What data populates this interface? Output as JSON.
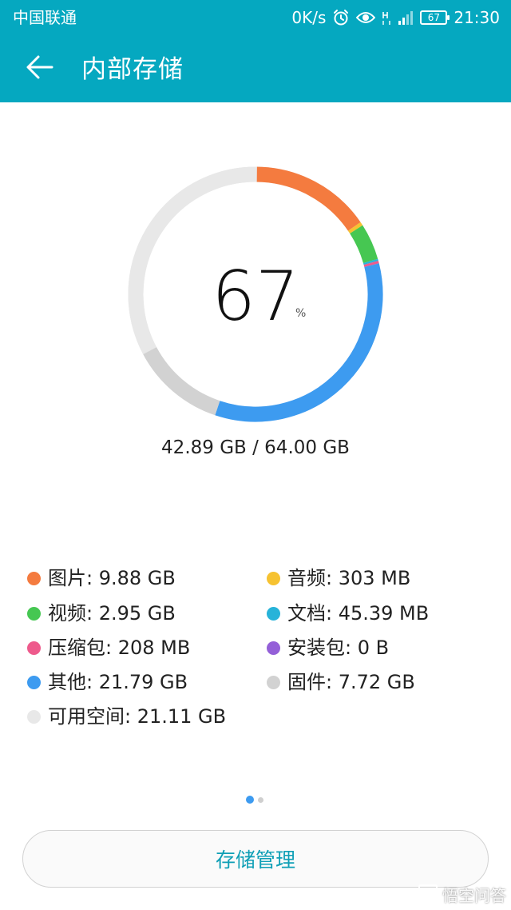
{
  "status_bar": {
    "carrier": "中国联通",
    "net_speed": "0K/s",
    "battery": "67",
    "time": "21:30",
    "icons": [
      "alarm-icon",
      "eye-icon",
      "hd-icon",
      "signal-icon",
      "battery-icon"
    ]
  },
  "app_bar": {
    "title": "内部存储",
    "back_icon": "arrow-left-icon"
  },
  "storage": {
    "percent": "67",
    "percent_unit": "%",
    "usage": "42.89 GB / 64.00 GB"
  },
  "chart_data": {
    "type": "pie",
    "total_gb": 64.0,
    "used_gb": 42.89,
    "slices": [
      {
        "label": "图片",
        "value_gb": 9.88,
        "color": "#f47b3f"
      },
      {
        "label": "音频",
        "value_gb": 0.303,
        "color": "#f6c231"
      },
      {
        "label": "视频",
        "value_gb": 2.95,
        "color": "#46c752"
      },
      {
        "label": "文档",
        "value_gb": 0.04539,
        "color": "#27b3d9"
      },
      {
        "label": "压缩包",
        "value_gb": 0.208,
        "color": "#ee5a8c"
      },
      {
        "label": "安装包",
        "value_gb": 0.0,
        "color": "#9460d8"
      },
      {
        "label": "其他",
        "value_gb": 21.79,
        "color": "#3d9bf0"
      },
      {
        "label": "固件",
        "value_gb": 7.72,
        "color": "#d2d2d2"
      },
      {
        "label": "可用空间",
        "value_gb": 21.11,
        "color": "#e8e8e8"
      }
    ]
  },
  "legend": {
    "items": [
      {
        "text": "图片: 9.88 GB",
        "color": "#f47b3f"
      },
      {
        "text": "音频: 303 MB",
        "color": "#f6c231"
      },
      {
        "text": "视频: 2.95 GB",
        "color": "#46c752"
      },
      {
        "text": "文档: 45.39 MB",
        "color": "#27b3d9"
      },
      {
        "text": "压缩包: 208 MB",
        "color": "#ee5a8c"
      },
      {
        "text": "安装包: 0 B",
        "color": "#9460d8"
      },
      {
        "text": "其他: 21.79 GB",
        "color": "#3d9bf0"
      },
      {
        "text": "固件: 7.72 GB",
        "color": "#d2d2d2"
      },
      {
        "text": "可用空间: 21.11 GB",
        "color": "#e8e8e8"
      }
    ]
  },
  "pager": {
    "pages": 2,
    "active_index": 0,
    "active_color": "#3d9bf0",
    "inactive_color": "#cfcfcf"
  },
  "actions": {
    "manage_label": "存储管理"
  },
  "watermark": {
    "text": "悟空问答"
  },
  "colors": {
    "accent": "#05a8c0"
  }
}
